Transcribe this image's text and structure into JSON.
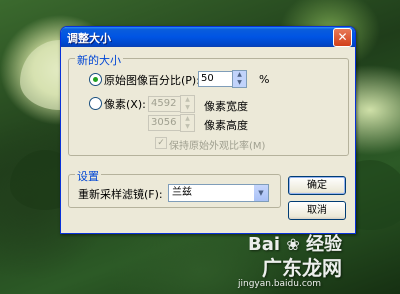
{
  "dialog": {
    "title": "调整大小",
    "close_glyph": "✕",
    "new_size_group": "新的大小",
    "percent_option": "原始图像百分比(P):",
    "percent_value": "50",
    "percent_unit": "%",
    "pixel_option": "像素(X):",
    "width_value": "4592",
    "width_label": "像素宽度",
    "height_value": "3056",
    "height_label": "像素高度",
    "keep_ratio": "保持原始外观比率(M)",
    "settings_group": "设置",
    "filter_label": "重新采样滤镜(F):",
    "filter_value": "兰兹",
    "ok_label": "确定",
    "cancel_label": "取消"
  },
  "watermark": {
    "brand_left": "Bai",
    "brand_right": "经验",
    "site": "广东龙网",
    "url": "jingyan.baidu.com"
  }
}
